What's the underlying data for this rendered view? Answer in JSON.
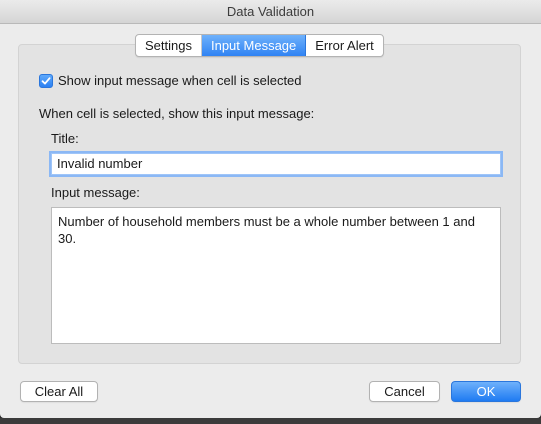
{
  "window": {
    "title": "Data Validation"
  },
  "tabs": [
    {
      "label": "Settings",
      "active": false
    },
    {
      "label": "Input Message",
      "active": true
    },
    {
      "label": "Error Alert",
      "active": false
    }
  ],
  "form": {
    "show_message_checkbox": {
      "label": "Show input message when cell is selected",
      "checked": true
    },
    "section_heading": "When cell is selected, show this input message:",
    "title_label": "Title:",
    "title_value": "Invalid number",
    "message_label": "Input message:",
    "message_value": "Number of household members must be a whole number between 1 and 30."
  },
  "buttons": {
    "clear_all": "Clear All",
    "cancel": "Cancel",
    "ok": "OK"
  },
  "colors": {
    "accent": "#2f83f3",
    "window_bg": "#ececec"
  }
}
